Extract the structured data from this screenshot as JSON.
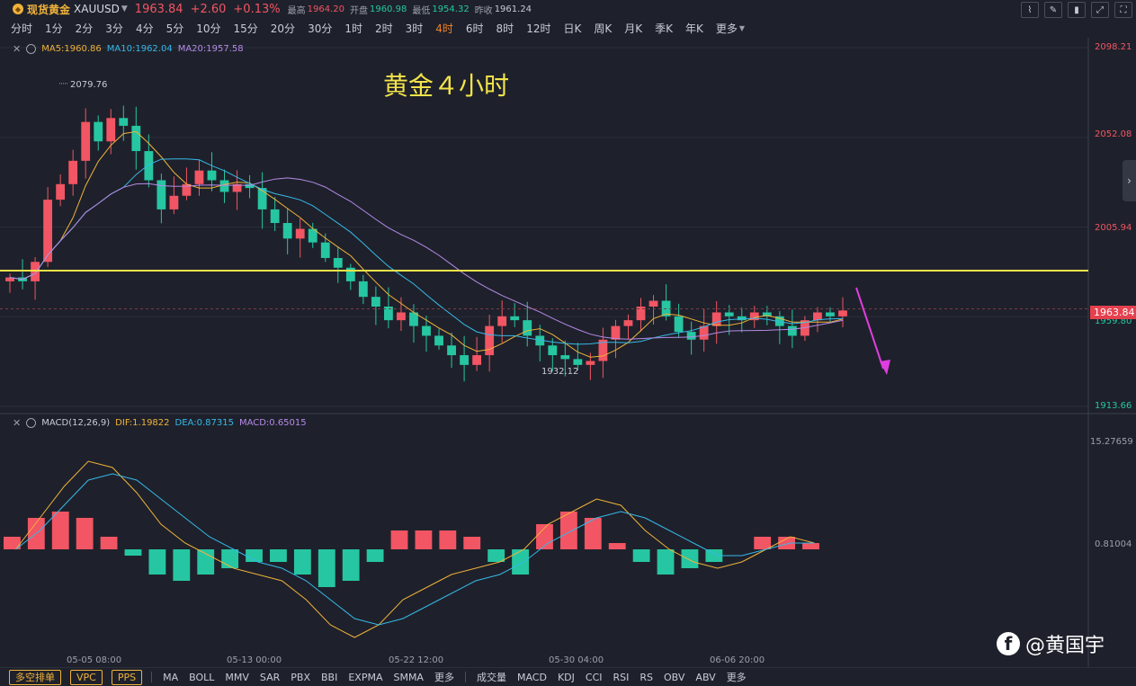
{
  "header": {
    "symbol_name": "现货黄金",
    "symbol_code": "XAUUSD",
    "price": "1963.84",
    "change": "+2.60",
    "change_pct": "+0.13%",
    "high_label": "最高",
    "high": "1964.20",
    "open_label": "开盘",
    "open": "1960.98",
    "low_label": "最低",
    "low": "1954.32",
    "prev_label": "昨收",
    "prev": "1961.24"
  },
  "timeframes": [
    "分时",
    "1分",
    "2分",
    "3分",
    "4分",
    "5分",
    "10分",
    "15分",
    "20分",
    "30分",
    "1时",
    "2时",
    "3时",
    "4时",
    "6时",
    "8时",
    "12时",
    "日K",
    "周K",
    "月K",
    "季K",
    "年K",
    "更多"
  ],
  "active_timeframe": "4时",
  "tool_icons": [
    "chart-type-icon",
    "draw-icon",
    "brush-icon",
    "expand-icon",
    "fullscreen-icon"
  ],
  "ma_legend": {
    "ma5": "MA5:1960.86",
    "ma10": "MA10:1962.04",
    "ma20": "MA20:1957.58"
  },
  "overlay_text": "黄金４小时",
  "price_annotations": {
    "high": "2079.76",
    "low": "1932.12"
  },
  "y_axis_main": [
    "2098.21",
    "2052.08",
    "2005.94",
    "1959.80",
    "1913.66"
  ],
  "current_price_badge": "1963.84",
  "macd_legend": {
    "title": "MACD(12,26,9)",
    "dif": "DIF:1.19822",
    "dea": "DEA:0.87315",
    "macd": "MACD:0.65015"
  },
  "y_axis_macd": [
    "15.27659",
    "0.81004"
  ],
  "x_axis_labels": [
    "05-05 08:00",
    "05-13 00:00",
    "05-22 12:00",
    "05-30 04:00",
    "06-06 20:00"
  ],
  "bottom_buttons": [
    "多空排单",
    "VPC",
    "PPS"
  ],
  "bottom_indicators_main": [
    "MA",
    "BOLL",
    "MMV",
    "SAR",
    "PBX",
    "BBI",
    "EXPMA",
    "SMMA",
    "更多"
  ],
  "bottom_indicators_sub": [
    "成交量",
    "MACD",
    "KDJ",
    "CCI",
    "RSI",
    "RS",
    "OBV",
    "ABV",
    "更多"
  ],
  "watermark": "@黄国宇",
  "colors": {
    "up": "#f25563",
    "down": "#26c6a2",
    "ma5": "#f0b23a",
    "ma10": "#37b8e8",
    "ma20": "#b68ae8",
    "hline": "#f3e34a",
    "arrow": "#e03de0"
  },
  "chart_data": {
    "type": "candlestick",
    "symbol": "XAUUSD",
    "ylim": [
      1913.66,
      2098.21
    ],
    "support_level": 1983.5,
    "close_series": [
      1980,
      1978,
      1988,
      2020,
      2028,
      2040,
      2060,
      2050,
      2062,
      2058,
      2045,
      2030,
      2015,
      2022,
      2028,
      2035,
      2030,
      2024,
      2028,
      2026,
      2015,
      2008,
      2000,
      2005,
      1998,
      1990,
      1985,
      1978,
      1970,
      1965,
      1958,
      1962,
      1955,
      1950,
      1945,
      1940,
      1935,
      1940,
      1955,
      1960,
      1958,
      1950,
      1945,
      1940,
      1938,
      1935,
      1937,
      1948,
      1955,
      1958,
      1965,
      1968,
      1960,
      1952,
      1948,
      1955,
      1962,
      1960,
      1958,
      1962,
      1960,
      1955,
      1950,
      1958,
      1962,
      1960,
      1963
    ],
    "macd": {
      "dif": [
        0,
        5,
        10,
        14,
        13,
        9,
        4,
        1,
        -1,
        -3,
        -4,
        -5,
        -8,
        -12,
        -14,
        -12,
        -8,
        -6,
        -4,
        -3,
        -2,
        0,
        4,
        6,
        8,
        7,
        3,
        0,
        -2,
        -3,
        -2,
        0,
        2,
        1
      ],
      "dea": [
        0,
        3,
        7,
        11,
        12,
        11,
        8,
        5,
        2,
        0,
        -2,
        -3,
        -5,
        -8,
        -11,
        -12,
        -11,
        -9,
        -7,
        -5,
        -4,
        -2,
        1,
        3,
        5,
        6,
        5,
        3,
        1,
        -1,
        -1,
        0,
        1,
        1
      ],
      "hist": [
        2,
        5,
        6,
        5,
        2,
        -1,
        -4,
        -5,
        -4,
        -3,
        -2,
        -2,
        -4,
        -6,
        -5,
        -2,
        3,
        3,
        3,
        2,
        -2,
        -4,
        4,
        6,
        5,
        1,
        -2,
        -4,
        -3,
        -2,
        0,
        2,
        2,
        1
      ]
    }
  }
}
